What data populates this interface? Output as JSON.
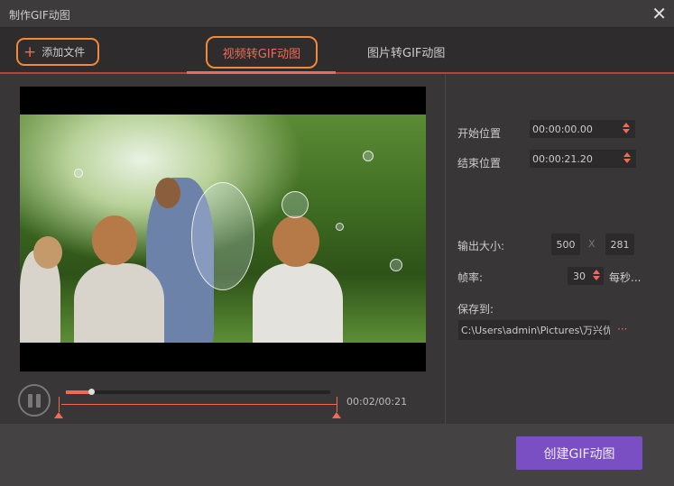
{
  "window": {
    "title": "制作GIF动图",
    "close_icon": "close-icon"
  },
  "toolbar": {
    "add_file_label": "添加文件"
  },
  "tabs": [
    {
      "label": "视频转GIF动图",
      "active": true
    },
    {
      "label": "图片转GIF动图",
      "active": false
    }
  ],
  "player": {
    "timecode": "00:02/00:21",
    "progress": 0.095,
    "range_start": 0.0,
    "range_end": 1.0
  },
  "settings": {
    "start_label": "开始位置",
    "start_value": "00:00:00.00",
    "end_label": "结束位置",
    "end_value": "00:00:21.20",
    "size_label": "输出大小:",
    "width": "500",
    "x_sep": "X",
    "height": "281",
    "fps_label": "帧率:",
    "fps_value": "30",
    "fps_unit": "每秒...",
    "save_label": "保存到:",
    "save_path": "C:\\Users\\admin\\Pictures\\万兴优",
    "browse_label": "···"
  },
  "footer": {
    "create_label": "创建GIF动图"
  },
  "colors": {
    "accent": "#f06a55",
    "outline": "#f08a3a",
    "button": "#7b4fc4"
  }
}
